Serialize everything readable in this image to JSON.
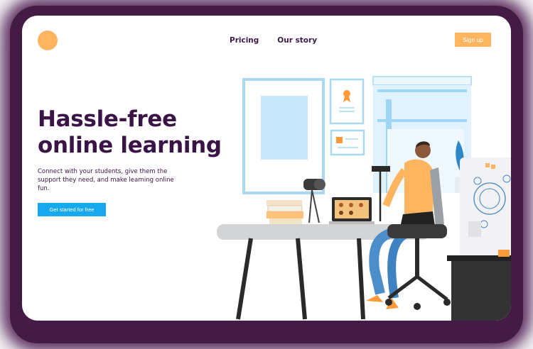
{
  "nav": {
    "items": [
      {
        "label": "Pricing"
      },
      {
        "label": "Our story"
      }
    ],
    "signup_label": "Sign up"
  },
  "hero": {
    "title_line1": "Hassle-free",
    "title_line2": "online learning",
    "subtitle": "Connect with your students, give them the support they need, and make learning online fun.",
    "cta_label": "Get started for free"
  },
  "colors": {
    "accent_orange": "#ffb55f",
    "cta_blue": "#17a8ee",
    "headline": "#3a1446",
    "frame_purple": "#3a0f3c"
  }
}
